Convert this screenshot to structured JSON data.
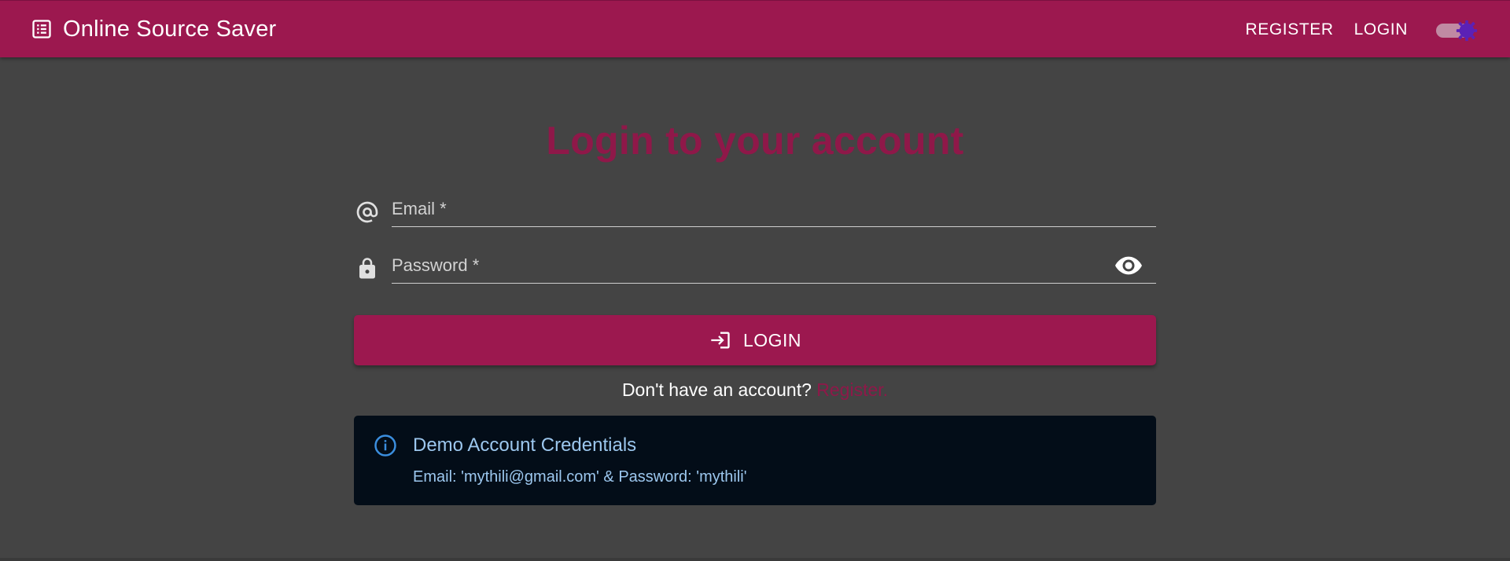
{
  "app": {
    "title": "Online Source Saver",
    "icon": "list-alt-icon"
  },
  "nav": {
    "register_label": "REGISTER",
    "login_label": "LOGIN",
    "theme_toggle": {
      "icon": "dark-mode-icon",
      "on": true
    }
  },
  "login_form": {
    "heading": "Login to your account",
    "email": {
      "placeholder": "Email *",
      "value": "",
      "icon": "at-sign-icon"
    },
    "password": {
      "placeholder": "Password *",
      "value": "",
      "icon": "lock-icon",
      "visibility_icon": "eye-icon"
    },
    "submit_label": "LOGIN",
    "submit_icon": "login-icon",
    "signup_prompt": "Don't have an account?",
    "signup_link": "Register."
  },
  "demo_alert": {
    "icon": "info-icon",
    "title": "Demo Account Credentials",
    "body": "Email: 'mythili@gmail.com' & Password: 'mythili'"
  },
  "colors": {
    "primary": "#9c184f",
    "background": "#444444",
    "heading": "#8f1849",
    "alert_bg": "#030d18",
    "alert_text": "#9cc7ee",
    "toggle_thumb": "#5b21b6"
  }
}
